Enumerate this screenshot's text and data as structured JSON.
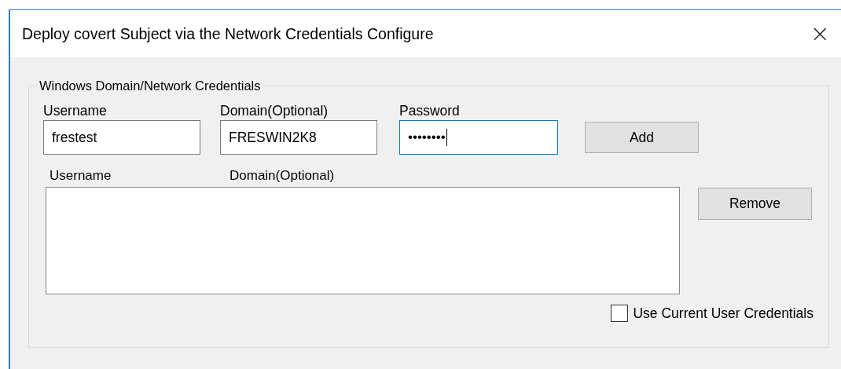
{
  "window": {
    "title": "Deploy covert Subject via the Network Credentials Configure",
    "close": "×"
  },
  "group": {
    "legend": "Windows Domain/Network Credentials",
    "fields": [
      {
        "label": "Username",
        "value": "frestest",
        "focused": false
      },
      {
        "label": "Domain(Optional)",
        "value": "FRESWIN2K8",
        "focused": false
      },
      {
        "label": "Password",
        "value": "••••••••",
        "focused": true
      }
    ],
    "add_button": "Add",
    "list": {
      "columns": [
        "Username",
        "Domain(Optional)"
      ]
    },
    "remove_button": "Remove",
    "use_current": {
      "label": "Use Current User Credentials",
      "checked": false
    }
  }
}
